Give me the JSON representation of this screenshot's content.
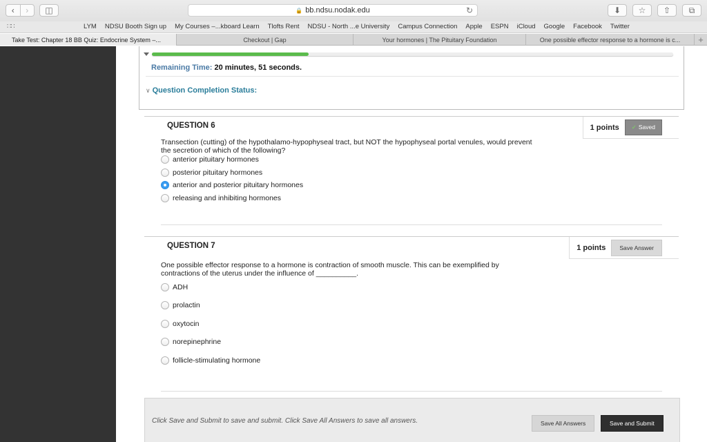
{
  "browser": {
    "url": "bb.ndsu.nodak.edu",
    "favorites": [
      "LYM",
      "NDSU Booth Sign up",
      "My Courses –...kboard Learn",
      "Tlofts Rent",
      "NDSU - North ...e University",
      "Campus Connection",
      "Apple",
      "ESPN",
      "iCloud",
      "Google",
      "Facebook",
      "Twitter"
    ],
    "tabs": [
      {
        "label": "Take Test: Chapter 18 BB Quiz: Endocrine System –..."
      },
      {
        "label": "Checkout | Gap"
      },
      {
        "label": "Your hormones | The Pituitary Foundation"
      },
      {
        "label": "One possible effector response to a hormone is c..."
      }
    ]
  },
  "status": {
    "progress_fraction": 0.3,
    "remaining_label": "Remaining Time:",
    "remaining_value": "20 minutes, 51 seconds.",
    "completion_label": "Question Completion Status:"
  },
  "questions": [
    {
      "title": "QUESTION 6",
      "points": "1 points",
      "state_label": "Saved",
      "text": "Transection (cutting) of the hypothalamo-hypophyseal tract, but NOT the hypophyseal portal venules, would prevent the secretion of which of the following?",
      "options": [
        "anterior pituitary hormones",
        "posterior pituitary hormones",
        "anterior and posterior pituitary hormones",
        "releasing and inhibiting hormones"
      ],
      "selected_index": 2
    },
    {
      "title": "QUESTION 7",
      "points": "1 points",
      "state_label": "Save Answer",
      "text": "One possible effector response to a hormone is contraction of smooth muscle.  This can be exemplified by contractions of the uterus under the influence of __________.",
      "options": [
        "ADH",
        "prolactin",
        "oxytocin",
        "norepinephrine",
        "follicle-stimulating hormone"
      ],
      "selected_index": -1
    }
  ],
  "footer": {
    "info": "Click Save and Submit to save and submit. Click Save All Answers to save all answers.",
    "save_all_label": "Save All Answers",
    "submit_label": "Save and Submit"
  },
  "colors": {
    "progress": "#5bbb4c",
    "link_blue": "#2a7d9a",
    "sidebar": "#333333",
    "selected_radio": "#3a9cf0"
  }
}
